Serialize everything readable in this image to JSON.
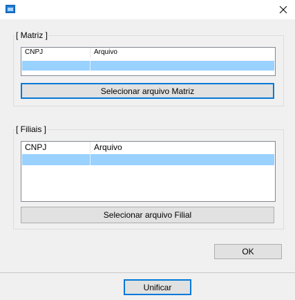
{
  "window": {
    "title": "",
    "icon": "app-window-icon",
    "close_glyph": "✕"
  },
  "matriz": {
    "legend": "[ Matriz ]",
    "columns": [
      "CNPJ",
      "Arquivo"
    ],
    "rows": [
      {
        "cnpj": "",
        "arquivo": "",
        "selected": true
      }
    ],
    "select_button": "Selecionar arquivo Matriz"
  },
  "filiais": {
    "legend": "[ Filiais ]",
    "columns": [
      "CNPJ",
      "Arquivo"
    ],
    "rows": [
      {
        "cnpj": "",
        "arquivo": "",
        "selected": true
      }
    ],
    "select_button": "Selecionar arquivo Filial"
  },
  "ok_button": "OK",
  "unificar_button": "Unificar",
  "colors": {
    "selection": "#99d1ff",
    "focus_border": "#0078d7",
    "dialog_bg": "#f0f0f0"
  }
}
